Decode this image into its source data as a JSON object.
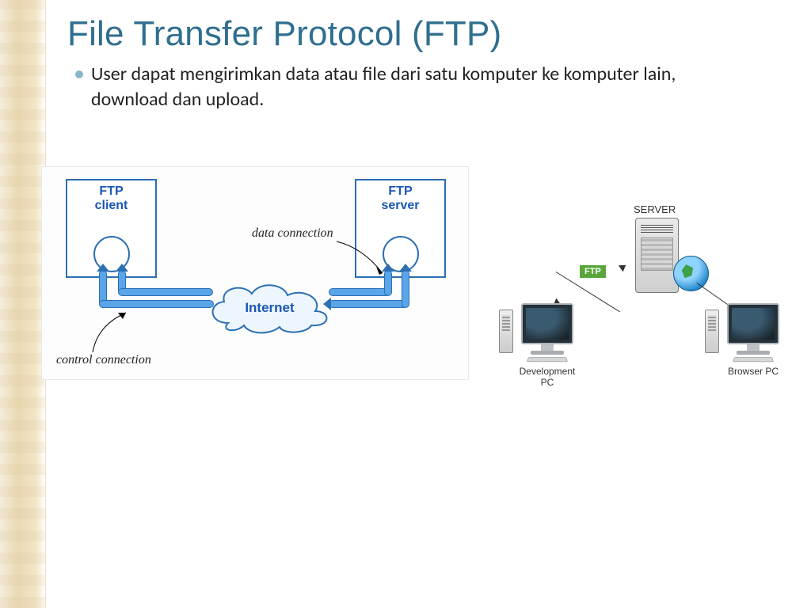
{
  "slide": {
    "title": "File Transfer Protocol (FTP)",
    "bullet": "User dapat mengirimkan data atau file dari satu komputer ke komputer lain, download dan upload."
  },
  "diagram1": {
    "ftp_client": "FTP\nclient",
    "ftp_server": "FTP\nserver",
    "internet": "Internet",
    "data_connection": "data connection",
    "control_connection": "control connection"
  },
  "diagram2": {
    "server": "SERVER",
    "ftp_tag": "FTP",
    "dev_pc": "Development PC",
    "browser_pc": "Browser PC"
  }
}
